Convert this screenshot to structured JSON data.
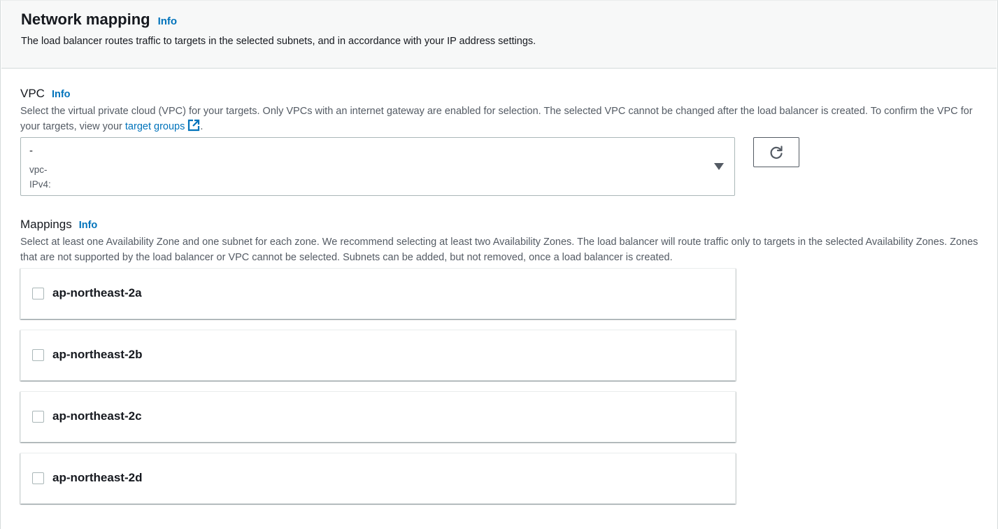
{
  "header": {
    "title": "Network mapping",
    "info": "Info",
    "description": "The load balancer routes traffic to targets in the selected subnets, and in accordance with your IP address settings."
  },
  "vpc": {
    "label": "VPC",
    "info": "Info",
    "description_before_link": "Select the virtual private cloud (VPC) for your targets. Only VPCs with an internet gateway are enabled for selection. The selected VPC cannot be changed after the load balancer is created. To confirm the VPC for your targets, view your ",
    "link_text": "target groups",
    "description_after_link": ".",
    "select": {
      "name_line": "-",
      "id_line": "vpc-",
      "ipv4_line": "IPv4:"
    },
    "refresh_icon": "refresh-icon",
    "external_link_icon": "external-link-icon"
  },
  "mappings": {
    "label": "Mappings",
    "info": "Info",
    "description": "Select at least one Availability Zone and one subnet for each zone. We recommend selecting at least two Availability Zones. The load balancer will route traffic only to targets in the selected Availability Zones. Zones that are not supported by the load balancer or VPC cannot be selected. Subnets can be added, but not removed, once a load balancer is created.",
    "zones": [
      {
        "name": "ap-northeast-2a",
        "checked": false
      },
      {
        "name": "ap-northeast-2b",
        "checked": false
      },
      {
        "name": "ap-northeast-2c",
        "checked": false
      },
      {
        "name": "ap-northeast-2d",
        "checked": false
      }
    ]
  },
  "colors": {
    "link": "#0073bb",
    "header_bg": "#f7f8f8",
    "text": "#16191f",
    "secondary_text": "#545b64"
  }
}
